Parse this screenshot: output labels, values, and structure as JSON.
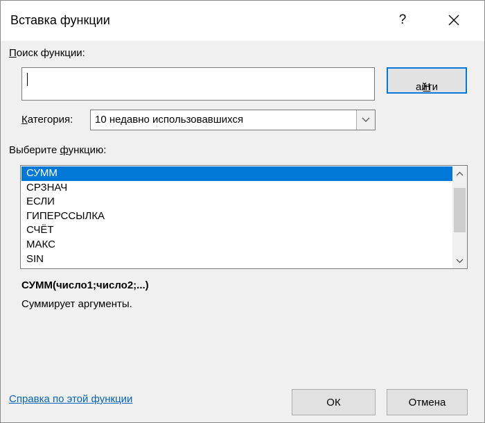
{
  "window": {
    "title": "Вставка функции",
    "help_glyph": "?",
    "close_icon": "close-icon"
  },
  "search": {
    "label_underlined": "П",
    "label_rest": "оиск функции:",
    "value": "",
    "find_button_underlined": "Н",
    "find_button_rest": "айти"
  },
  "category": {
    "label_underlined": "К",
    "label_rest": "атегория:",
    "selected": "10 недавно использовавшихся"
  },
  "function_list": {
    "label_before": "Выберите ",
    "label_underlined": "ф",
    "label_after": "ункцию:",
    "items": [
      "СУММ",
      "СРЗНАЧ",
      "ЕСЛИ",
      "ГИПЕРССЫЛКА",
      "СЧЁТ",
      "МАКС",
      "SIN"
    ],
    "selected_index": 0
  },
  "details": {
    "signature": "СУММ(число1;число2;...)",
    "description": "Суммирует аргументы."
  },
  "footer": {
    "help_link": "Справка по этой функции",
    "ok": "ОК",
    "cancel": "Отмена"
  },
  "colors": {
    "selection": "#0078d7",
    "link": "#0563c1",
    "dialog_bg": "#f0f0f0"
  }
}
